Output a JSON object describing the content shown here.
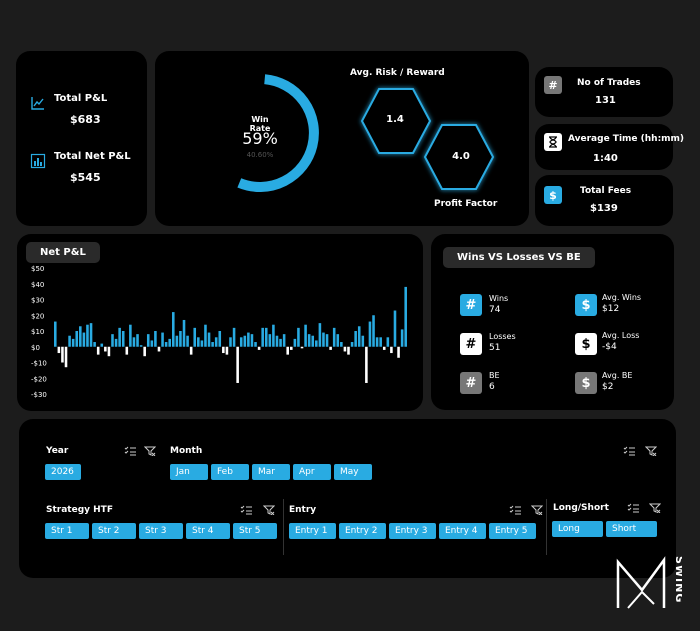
{
  "total_pnl": {
    "label": "Total P&L",
    "value": "$683"
  },
  "total_net_pnl": {
    "label": "Total Net P&L",
    "value": "$545"
  },
  "win_rate": {
    "label": "Win Rate",
    "value": "59%",
    "sub": "40.60%",
    "fraction": 0.59
  },
  "risk_reward": {
    "title": "Avg. Risk / Reward",
    "value": "1.4"
  },
  "profit_factor": {
    "title": "Profit Factor",
    "value": "4.0"
  },
  "trades": {
    "label": "No of Trades",
    "value": "131",
    "icon": "#"
  },
  "avg_time": {
    "label": "Average Time (hh:mm)",
    "value": "1:40"
  },
  "fees": {
    "label": "Total Fees",
    "value": "$139",
    "icon": "$"
  },
  "net_pnl_title": "Net P&L",
  "chart_data": {
    "type": "bar",
    "title": "Net P&L",
    "y_ticks": [
      "$50",
      "$40",
      "$30",
      "$20",
      "$10",
      "$0",
      "-$10",
      "-$20",
      "-$30"
    ],
    "ylim": [
      -30,
      50
    ],
    "values": [
      16,
      -4,
      -10,
      -13,
      7,
      5,
      10,
      13,
      9,
      14,
      15,
      3,
      -5,
      2,
      -3,
      -6,
      8,
      5,
      12,
      10,
      -5,
      14,
      6,
      8,
      1,
      -6,
      8,
      4,
      10,
      -3,
      9,
      3,
      5,
      22,
      7,
      10,
      17,
      7,
      -5,
      12,
      6,
      4,
      14,
      9,
      3,
      6,
      10,
      -4,
      -5,
      6,
      12,
      -23,
      6,
      7,
      9,
      8,
      3,
      -2,
      12,
      12,
      8,
      14,
      7,
      5,
      8,
      -5,
      -2,
      5,
      12,
      -1,
      14,
      8,
      7,
      4,
      15,
      9,
      8,
      -2,
      12,
      8,
      3,
      -3,
      -5,
      3,
      10,
      13,
      7,
      -23,
      16,
      20,
      6,
      6,
      -2,
      6,
      -4,
      23,
      -7,
      11,
      38
    ]
  },
  "wlb": {
    "title": "Wins VS Losses VS BE",
    "wins": {
      "label": "Wins",
      "value": "74",
      "icon": "#"
    },
    "avg_wins": {
      "label": "Avg. Wins",
      "value": "$12",
      "icon": "$"
    },
    "losses": {
      "label": "Losses",
      "value": "51",
      "icon": "#"
    },
    "avg_loss": {
      "label": "Avg. Loss",
      "value": "-$4",
      "icon": "$"
    },
    "be": {
      "label": "BE",
      "value": "6",
      "icon": "#"
    },
    "avg_be": {
      "label": "Avg. BE",
      "value": "$2",
      "icon": "$"
    }
  },
  "filters": {
    "year": {
      "title": "Year",
      "items": [
        "2026"
      ]
    },
    "month": {
      "title": "Month",
      "items": [
        "Jan",
        "Feb",
        "Mar",
        "Apr",
        "May"
      ]
    },
    "strategy": {
      "title": "Strategy HTF",
      "items": [
        "Str 1",
        "Str 2",
        "Str 3",
        "Str 4",
        "Str 5"
      ]
    },
    "entry": {
      "title": "Entry",
      "items": [
        "Entry 1",
        "Entry 2",
        "Entry 3",
        "Entry 4",
        "Entry 5"
      ]
    },
    "long_short": {
      "title": "Long/Short",
      "items": [
        "Long",
        "Short"
      ]
    }
  },
  "watermark_text": "SWING",
  "colors": {
    "accent": "#29abe2",
    "panel": "#000000",
    "background": "#1c1c1c",
    "muted": "#888888"
  }
}
